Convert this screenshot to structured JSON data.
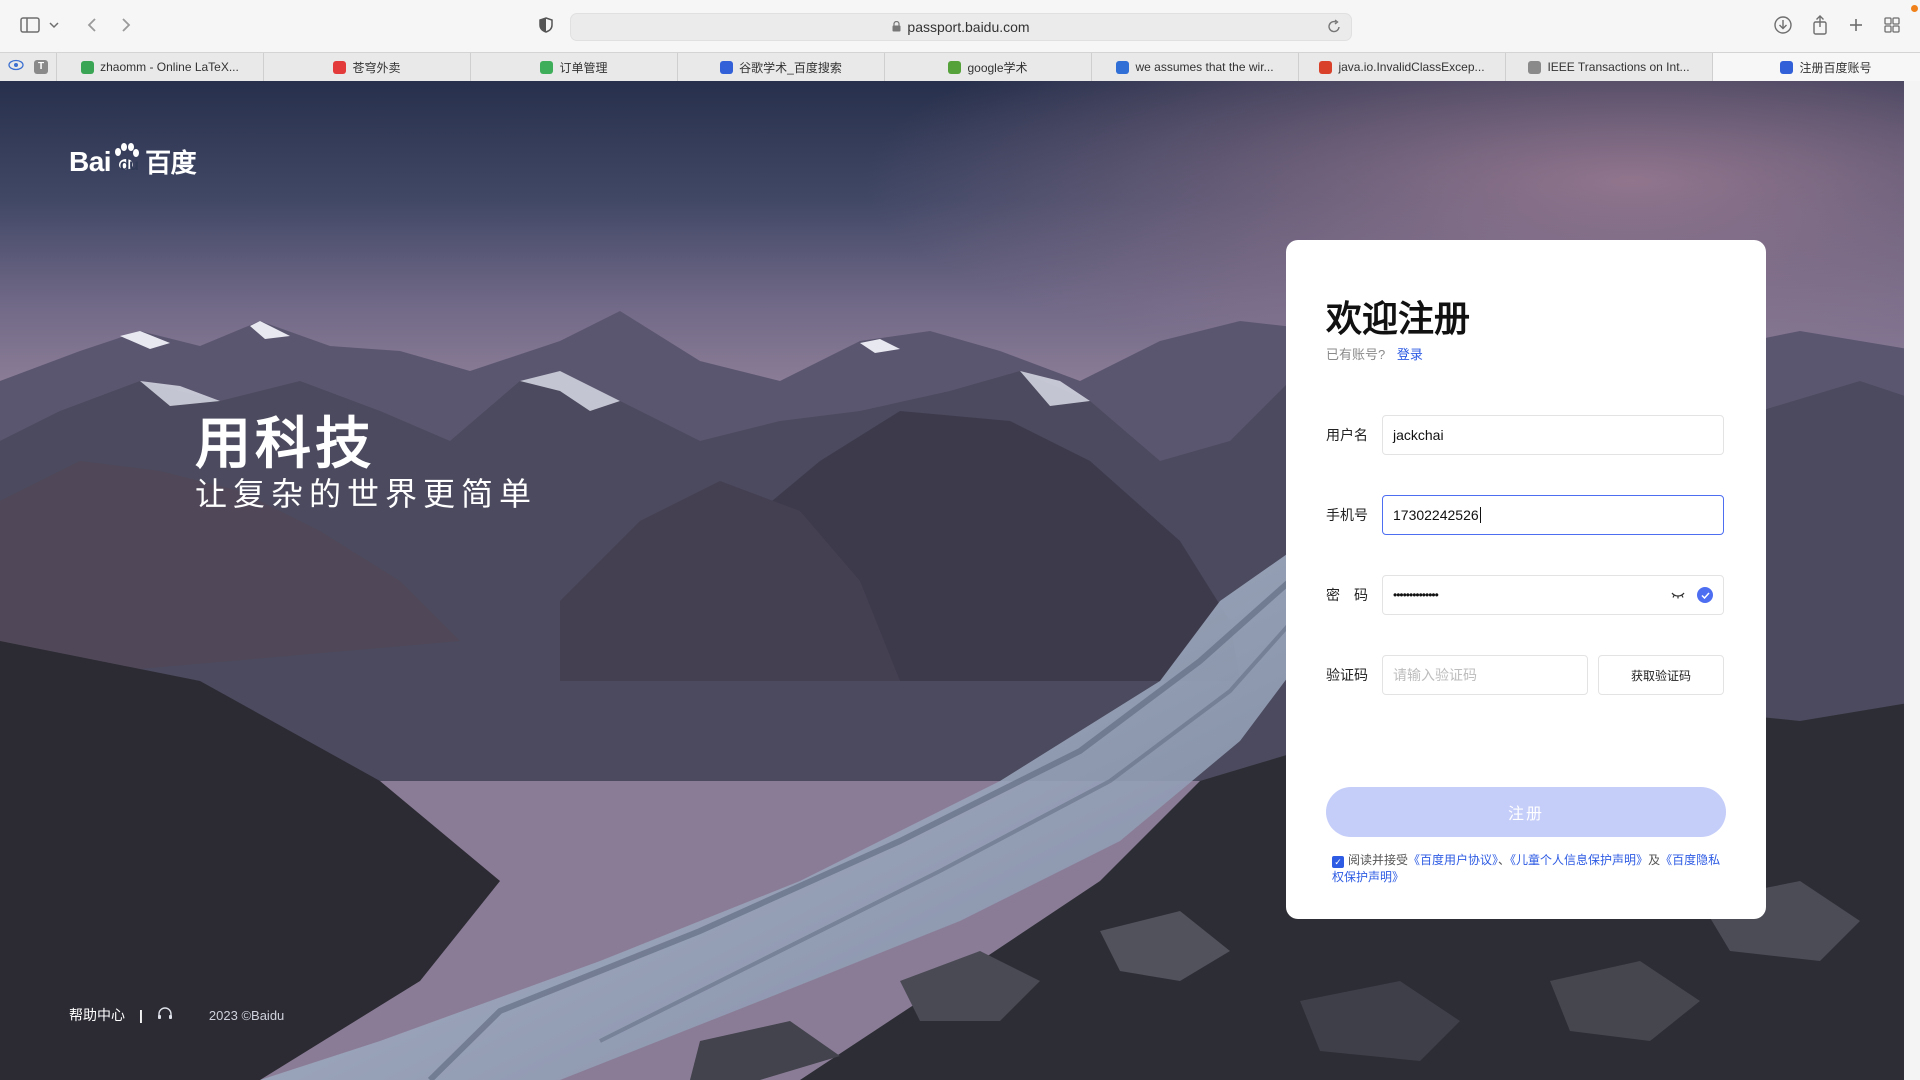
{
  "browser": {
    "url": "passport.baidu.com",
    "tabs": [
      {
        "title": "zhaomm - Online LaTeX...",
        "color": "#3aa655"
      },
      {
        "title": "苍穹外卖",
        "color": "#e33b3b"
      },
      {
        "title": "订单管理",
        "color": "#3fae5a"
      },
      {
        "title": "谷歌学术_百度搜索",
        "color": "#3160d8"
      },
      {
        "title": "google学术",
        "color": "#56a23a"
      },
      {
        "title": "we assumes that the wir...",
        "color": "#2f6fd6"
      },
      {
        "title": "java.io.InvalidClassExcep...",
        "color": "#d9412b"
      },
      {
        "title": "IEEE Transactions on Int...",
        "color": "#8a8a8a"
      },
      {
        "title": "注册百度账号",
        "color": "#3160d8"
      }
    ]
  },
  "page": {
    "logo_text": "Bai",
    "logo_text2": "du",
    "logo_text3": "百度",
    "hero_title": "用科技",
    "hero_subtitle": "让复杂的世界更简单",
    "footer": {
      "help": "帮助中心",
      "separator": "|",
      "copyright": "2023 ©Baidu"
    }
  },
  "form": {
    "title": "欢迎注册",
    "have_account": "已有账号?",
    "login_link": "登录",
    "username_label": "用户名",
    "username_value": "jackchai",
    "phone_label": "手机号",
    "phone_value": "17302242526",
    "password_label": "密　码",
    "password_value": "••••••••••••••",
    "code_label": "验证码",
    "code_placeholder": "请输入验证码",
    "get_code_button": "获取验证码",
    "submit_button": "注册",
    "agree_prefix": "阅读并接受",
    "agree_link1": "《百度用户协议》",
    "agree_sep": "、",
    "agree_link2": "《儿童个人信息保护声明》",
    "agree_and": "及",
    "agree_link3": "《百度隐私权保护声明》"
  }
}
